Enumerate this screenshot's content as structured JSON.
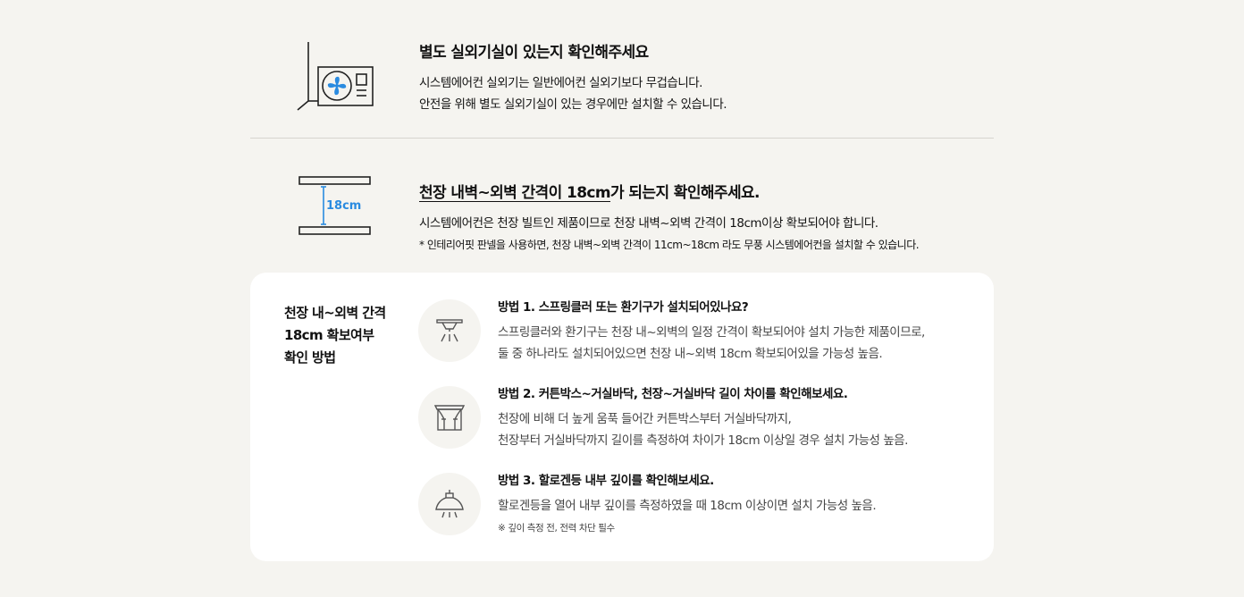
{
  "section1": {
    "title": "별도 실외기실이 있는지 확인해주세요",
    "desc_line1": "시스템에어컨 실외기는 일반에어컨 실외기보다 무겁습니다.",
    "desc_line2": "안전을 위해 별도 실외기실이 있는 경우에만 설치할 수 있습니다.",
    "icon": "outdoor-unit-icon"
  },
  "section2": {
    "title_underlined": "천장 내벽~외벽 간격이 18cm",
    "title_rest": "가 되는지 확인해주세요.",
    "desc": "시스템에어컨은 천장 빌트인 제품이므로 천장 내벽~외벽 간격이 18cm이상 확보되어야 합니다.",
    "note": "* 인테리어핏 판넬을 사용하면, 천장 내벽~외벽 간격이 11cm~18cm 라도 무풍 시스템에어컨을 설치할 수 있습니다.",
    "icon_label": "18cm",
    "icon": "ceiling-gap-icon",
    "accent_color": "#2a8be0"
  },
  "card": {
    "heading_line1": "천장 내~외벽 간격",
    "heading_line2": "18cm 확보여부",
    "heading_line3": "확인 방법",
    "methods": [
      {
        "title": "방법 1. 스프링클러 또는 환기구가 설치되어있나요?",
        "desc_line1": "스프링클러와 환기구는 천장 내~외벽의 일정 간격이 확보되어야 설치 가능한 제품이므로,",
        "desc_line2": "둘 중 하나라도 설치되어있으면 천장 내~외벽 18cm 확보되어있을 가능성 높음.",
        "icon": "sprinkler-icon"
      },
      {
        "title": "방법 2. 커튼박스~거실바닥, 천장~거실바닥 길이 차이를 확인해보세요.",
        "desc_line1": "천장에 비해 더 높게 움푹 들어간 커튼박스부터 거실바닥까지,",
        "desc_line2": "천장부터 거실바닥까지 길이를 측정하여 차이가 18cm 이상일 경우 설치 가능성 높음.",
        "icon": "curtain-box-icon"
      },
      {
        "title": "방법 3. 할로겐등 내부 깊이를 확인해보세요.",
        "desc_line1": "할로겐등을 열어 내부 깊이를 측정하였을 때 18cm 이상이면 설치 가능성 높음.",
        "note": "※ 깊이 측정 전, 전력 차단 필수",
        "icon": "halogen-lamp-icon"
      }
    ]
  },
  "colors": {
    "background": "#f5f4f0",
    "card": "#ffffff",
    "accent": "#2a8be0"
  }
}
